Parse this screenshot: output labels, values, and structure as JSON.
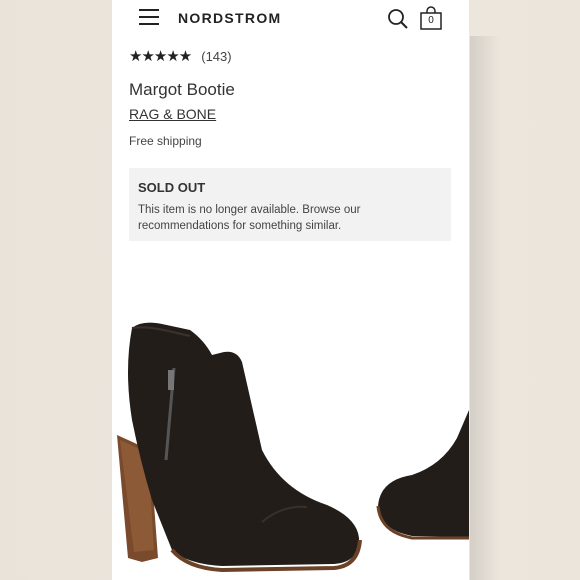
{
  "header": {
    "brand": "NORDSTROM",
    "bag_count": "0",
    "icons": [
      "menu-icon",
      "search-icon",
      "shopping-bag-icon"
    ]
  },
  "product": {
    "rating_stars": "★★★★★",
    "rating_value": 4.5,
    "review_count": "(143)",
    "name": "Margot Bootie",
    "brand": "RAG & BONE",
    "shipping": "Free shipping"
  },
  "availability": {
    "title": "SOLD OUT",
    "message": "This item is no longer available. Browse our recommendations for something similar."
  },
  "colors": {
    "background": "#ece6dc",
    "text": "#333333",
    "notice_bg": "#f2f2f2"
  }
}
